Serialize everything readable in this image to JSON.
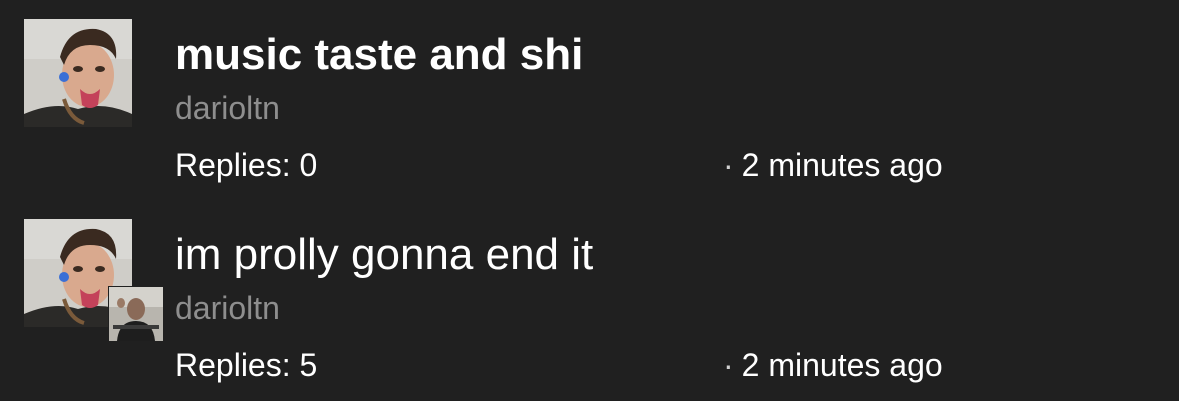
{
  "threads": [
    {
      "title": "music taste and shi",
      "author": "darioltn",
      "replies_label": "Replies: 0",
      "separator": "·",
      "timestamp": "2 minutes ago",
      "avatar_icon": "user-photo-icon"
    },
    {
      "title": "im prolly gonna end it",
      "author": "darioltn",
      "replies_label": "Replies: 5",
      "separator": "·",
      "timestamp": "2 minutes ago",
      "avatar_icon": "user-photo-icon",
      "reply_avatar_icon": "replier-photo-icon"
    }
  ],
  "colors": {
    "background": "#202020",
    "title": "#ffffff",
    "author": "#8e8e8e",
    "meta": "#ffffff"
  }
}
